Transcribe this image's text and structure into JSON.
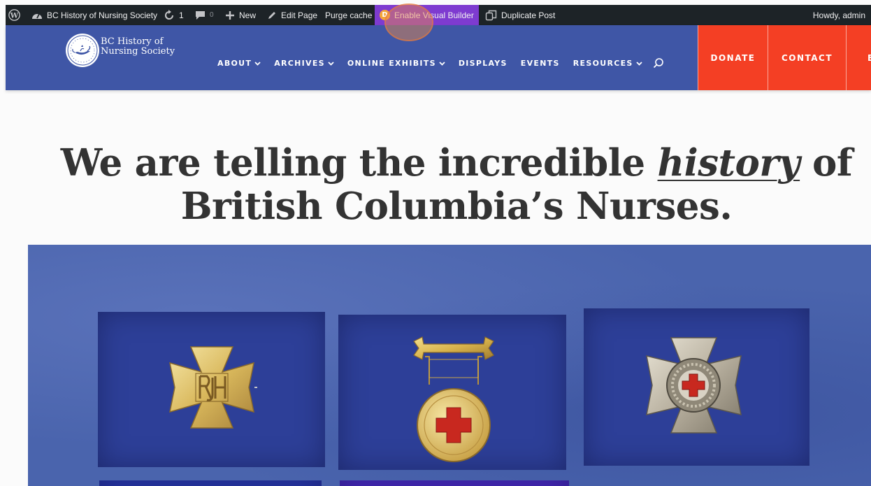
{
  "adminbar": {
    "site_name": "BC History of Nursing Society",
    "updates_count": "1",
    "comments_count": "0",
    "new_label": "New",
    "edit_page_label": "Edit Page",
    "purge_cache_label": "Purge cache",
    "visual_builder_badge": "D",
    "visual_builder_label": "Enable Visual Builder",
    "duplicate_label": "Duplicate Post",
    "greeting": "Howdy, admin"
  },
  "header": {
    "logo_line1": "BC History of",
    "logo_line2": "Nursing Society",
    "nav": [
      {
        "label": "ABOUT",
        "dropdown": true
      },
      {
        "label": "ARCHIVES",
        "dropdown": true
      },
      {
        "label": "ONLINE EXHIBITS",
        "dropdown": true
      },
      {
        "label": "DISPLAYS",
        "dropdown": false
      },
      {
        "label": "EVENTS",
        "dropdown": false
      },
      {
        "label": "RESOURCES",
        "dropdown": true
      }
    ],
    "cta_donate": "DONATE",
    "cta_contact": "CONTACT",
    "cta_more": "B"
  },
  "hero": {
    "line1_before": "We are telling the incredible ",
    "line1_emphasis": "history",
    "line1_after": " of",
    "line2": "British Columbia’s Nurses."
  },
  "colors": {
    "adminbar_bg": "#1d2327",
    "visual_builder_bg": "#7e3bd0",
    "header_bg": "#3f56a6",
    "cta_bg": "#f43f24",
    "felt_bg": "#4a64ad"
  },
  "icons": {
    "wordpress": "wordpress-logo-icon",
    "dashboard": "dashboard-gauge-icon",
    "updates": "refresh-icon",
    "comments": "comment-bubble-icon",
    "new": "plus-icon",
    "edit": "pencil-icon",
    "duplicate": "duplicate-icon",
    "search": "search-icon"
  }
}
